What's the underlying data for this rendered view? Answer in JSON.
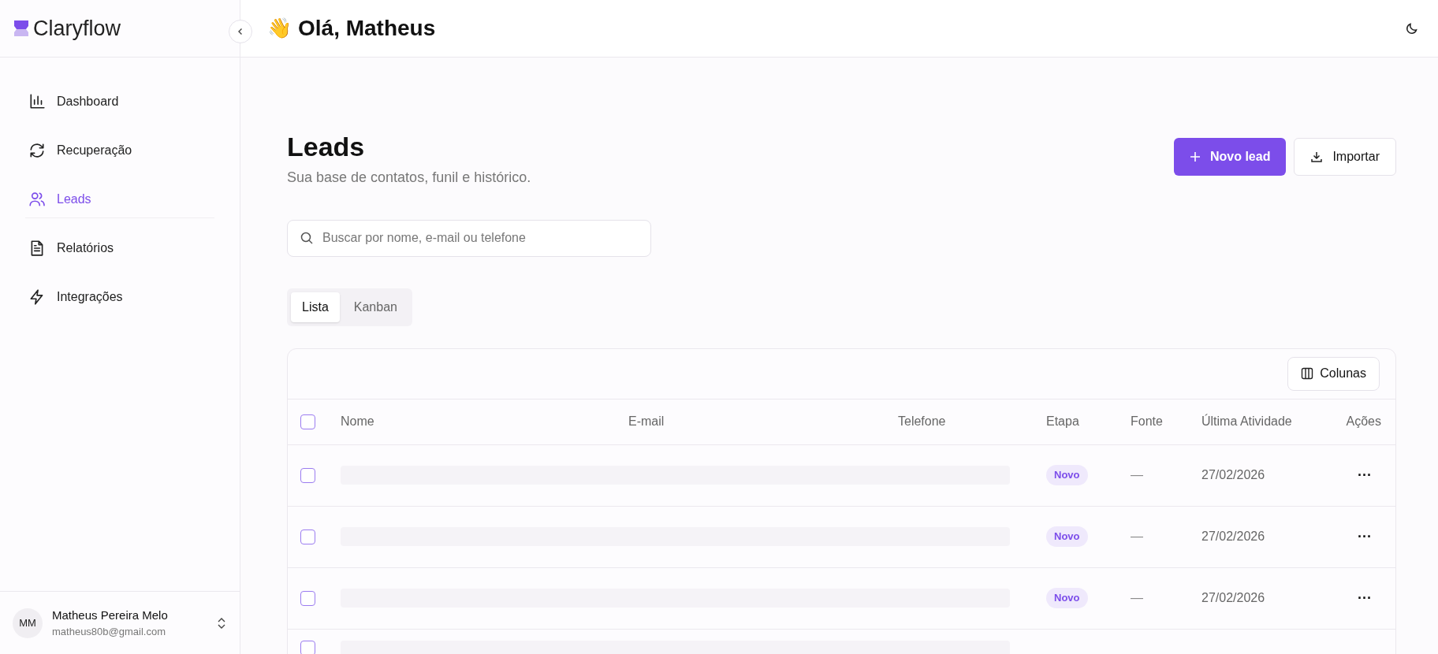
{
  "brand": {
    "name": "Claryflow"
  },
  "header": {
    "emoji": "👋",
    "greeting": "Olá, Matheus"
  },
  "sidebar": {
    "items": [
      {
        "label": "Dashboard",
        "kind": "chart",
        "selected": false
      },
      {
        "label": "Recuperação",
        "kind": "refresh",
        "selected": false
      },
      {
        "label": "Leads",
        "kind": "users",
        "selected": true
      },
      {
        "label": "Relatórios",
        "kind": "file",
        "selected": false
      },
      {
        "label": "Integrações",
        "kind": "bolt",
        "selected": false
      }
    ]
  },
  "user": {
    "initials": "MM",
    "name": "Matheus Pereira Melo",
    "email": "matheus80b@gmail.com"
  },
  "page": {
    "title": "Leads",
    "subtitle": "Sua base de contatos, funil e histórico.",
    "buttons": [
      {
        "label": "Novo lead",
        "kind": "primary"
      },
      {
        "label": "Importar",
        "kind": "secondary"
      }
    ]
  },
  "search": {
    "placeholder": "Buscar por nome, e-mail ou telefone"
  },
  "tabs": [
    {
      "label": "Lista",
      "selected": true
    },
    {
      "label": "Kanban",
      "selected": false
    }
  ],
  "table": {
    "toolbar_button": "Colunas",
    "header_checked": false,
    "columns": [
      "Nome",
      "E-mail",
      "Telefone",
      "Etapa",
      "Fonte",
      "Última Atividade",
      "Ações"
    ],
    "rows": [
      {
        "kind": "redacted",
        "checked": false,
        "stage": "Novo",
        "source": "—",
        "date": "27/02/2026",
        "actions": "···"
      },
      {
        "kind": "redacted",
        "checked": false,
        "stage": "Novo",
        "source": "—",
        "date": "27/02/2026",
        "actions": "···"
      },
      {
        "kind": "redacted",
        "checked": false,
        "stage": "Novo",
        "source": "—",
        "date": "27/02/2026",
        "actions": "···"
      },
      {
        "kind": "cut",
        "checked": false
      }
    ]
  }
}
